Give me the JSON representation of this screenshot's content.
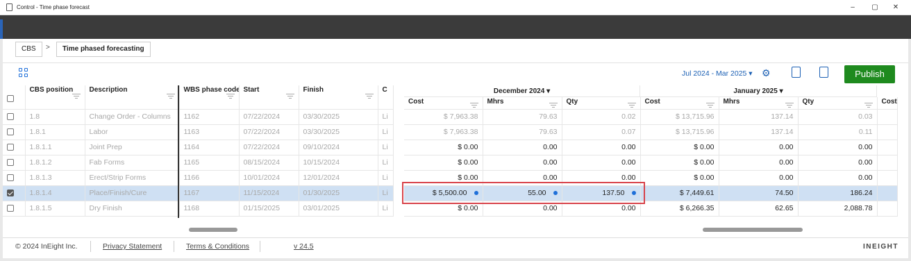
{
  "window": {
    "title": "Control - Time phase forecast",
    "min": "–",
    "max": "▢",
    "close": "✕"
  },
  "breadcrumb": {
    "root": "CBS",
    "sep": ">",
    "current": "Time phased forecasting"
  },
  "toolbar": {
    "range": "Jul 2024 - Mar 2025 ▾",
    "publish": "Publish"
  },
  "left": {
    "headers": {
      "cbs": "CBS position",
      "desc": "Description",
      "wbs": "WBS phase code",
      "start": "Start",
      "finish": "Finish",
      "c": "C"
    },
    "rows": [
      {
        "cbs": "1.8",
        "desc": "Change Order - Columns",
        "wbs": "1162",
        "start": "07/22/2024",
        "finish": "03/30/2025",
        "c": "Li"
      },
      {
        "cbs": "1.8.1",
        "desc": "Labor",
        "wbs": "1163",
        "start": "07/22/2024",
        "finish": "03/30/2025",
        "c": "Li"
      },
      {
        "cbs": "1.8.1.1",
        "desc": "Joint Prep",
        "wbs": "1164",
        "start": "07/22/2024",
        "finish": "09/10/2024",
        "c": "Li"
      },
      {
        "cbs": "1.8.1.2",
        "desc": "Fab Forms",
        "wbs": "1165",
        "start": "08/15/2024",
        "finish": "10/15/2024",
        "c": "Li"
      },
      {
        "cbs": "1.8.1.3",
        "desc": "Erect/Strip Forms",
        "wbs": "1166",
        "start": "10/01/2024",
        "finish": "12/01/2024",
        "c": "Li"
      },
      {
        "cbs": "1.8.1.4",
        "desc": "Place/Finish/Cure",
        "wbs": "1167",
        "start": "11/15/2024",
        "finish": "01/30/2025",
        "c": "Li"
      },
      {
        "cbs": "1.8.1.5",
        "desc": "Dry Finish",
        "wbs": "1168",
        "start": "01/15/2025",
        "finish": "03/01/2025",
        "c": "Li"
      }
    ]
  },
  "right": {
    "months": [
      {
        "label": "December 2024 ▾"
      },
      {
        "label": "January 2025 ▾"
      }
    ],
    "cols": {
      "cost": "Cost",
      "mhrs": "Mhrs",
      "qty": "Qty"
    },
    "rows": [
      {
        "dc": "$ 7,963.38",
        "dm": "79.63",
        "dq": "0.02",
        "jc": "$ 13,715.96",
        "jm": "137.14",
        "jq": "0.03"
      },
      {
        "dc": "$ 7,963.38",
        "dm": "79.63",
        "dq": "0.07",
        "jc": "$ 13,715.96",
        "jm": "137.14",
        "jq": "0.11"
      },
      {
        "dc": "$ 0.00",
        "dm": "0.00",
        "dq": "0.00",
        "jc": "$ 0.00",
        "jm": "0.00",
        "jq": "0.00"
      },
      {
        "dc": "$ 0.00",
        "dm": "0.00",
        "dq": "0.00",
        "jc": "$ 0.00",
        "jm": "0.00",
        "jq": "0.00"
      },
      {
        "dc": "$ 0.00",
        "dm": "0.00",
        "dq": "0.00",
        "jc": "$ 0.00",
        "jm": "0.00",
        "jq": "0.00"
      },
      {
        "dc": "$ 5,500.00",
        "dm": "55.00",
        "dq": "137.50",
        "jc": "$ 7,449.61",
        "jm": "74.50",
        "jq": "186.24"
      },
      {
        "dc": "$ 0.00",
        "dm": "0.00",
        "dq": "0.00",
        "jc": "$ 6,266.35",
        "jm": "62.65",
        "jq": "2,088.78"
      }
    ]
  },
  "footer": {
    "copy": "© 2024 InEight Inc.",
    "privacy": "Privacy Statement",
    "terms": "Terms & Conditions",
    "version": "v 24.5",
    "logo": "INEIGHT"
  },
  "colors": {
    "accent": "#1a5fb4",
    "publish": "#1e8a1e",
    "highlight": "#d8434a",
    "selected": "#cfe0f3"
  }
}
